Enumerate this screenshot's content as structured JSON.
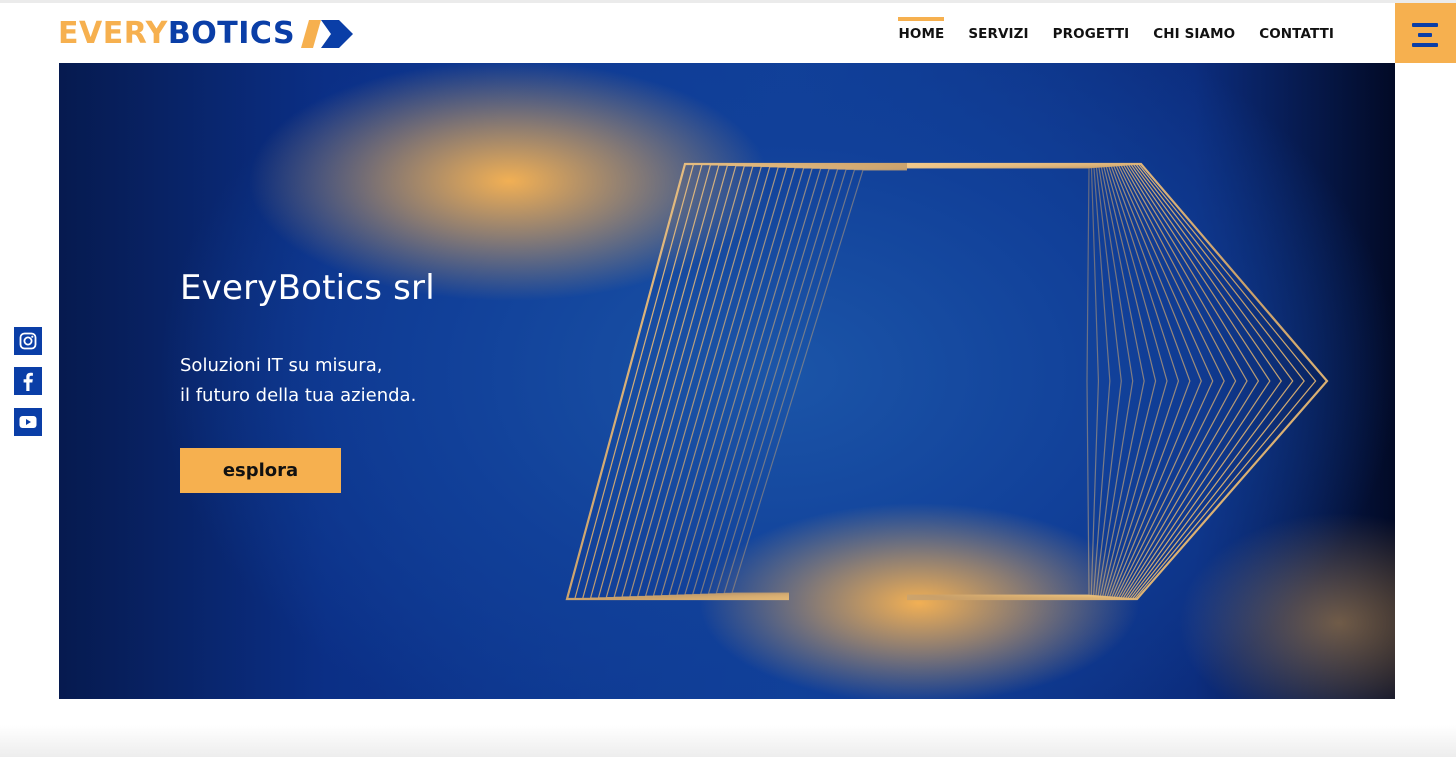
{
  "brand": {
    "part1": "EVERY",
    "part2": "BOTICS",
    "colors": {
      "orange": "#f6b04f",
      "blue": "#0a3ea7"
    }
  },
  "nav": {
    "items": [
      {
        "label": "HOME",
        "active": true
      },
      {
        "label": "SERVIZI",
        "active": false
      },
      {
        "label": "PROGETTI",
        "active": false
      },
      {
        "label": "CHI SIAMO",
        "active": false
      },
      {
        "label": "CONTATTI",
        "active": false
      }
    ],
    "menu_icon": "hamburger-menu-icon"
  },
  "hero": {
    "title": "EveryBotics srl",
    "subtitle_line1": "Soluzioni IT su misura,",
    "subtitle_line2": "il futuro della tua azienda.",
    "cta_label": "esplora"
  },
  "social": [
    {
      "icon": "instagram-icon"
    },
    {
      "icon": "facebook-icon"
    },
    {
      "icon": "youtube-icon"
    }
  ]
}
